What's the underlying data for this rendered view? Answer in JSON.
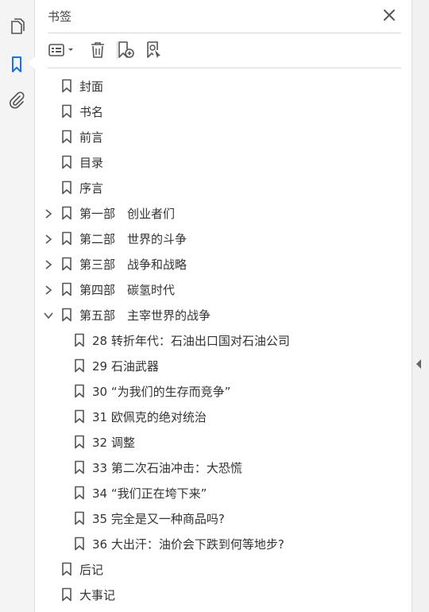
{
  "panel": {
    "title": "书签"
  },
  "bookmarks": [
    {
      "label": "封面",
      "level": 0,
      "expander": "none"
    },
    {
      "label": "书名",
      "level": 0,
      "expander": "none"
    },
    {
      "label": "前言",
      "level": 0,
      "expander": "none"
    },
    {
      "label": "目录",
      "level": 0,
      "expander": "none"
    },
    {
      "label": "序言",
      "level": 0,
      "expander": "none"
    },
    {
      "label": "第一部　创业者们",
      "level": 0,
      "expander": "collapsed"
    },
    {
      "label": "第二部　世界的斗争",
      "level": 0,
      "expander": "collapsed"
    },
    {
      "label": "第三部　战争和战略",
      "level": 0,
      "expander": "collapsed"
    },
    {
      "label": "第四部　碳氢时代",
      "level": 0,
      "expander": "collapsed"
    },
    {
      "label": "第五部　主宰世界的战争",
      "level": 0,
      "expander": "expanded"
    },
    {
      "label": "28 转折年代：石油出口国对石油公司",
      "level": 1,
      "expander": "none"
    },
    {
      "label": "29 石油武器",
      "level": 1,
      "expander": "none"
    },
    {
      "label": "30 “为我们的生存而竞争”",
      "level": 1,
      "expander": "none"
    },
    {
      "label": "31 欧佩克的绝对统治",
      "level": 1,
      "expander": "none"
    },
    {
      "label": "32 调整",
      "level": 1,
      "expander": "none"
    },
    {
      "label": "33 第二次石油冲击：大恐慌",
      "level": 1,
      "expander": "none"
    },
    {
      "label": "34 “我们正在垮下来”",
      "level": 1,
      "expander": "none"
    },
    {
      "label": "35 完全是又一种商品吗?",
      "level": 1,
      "expander": "none"
    },
    {
      "label": "36 大出汗：油价会下跌到何等地步?",
      "level": 1,
      "expander": "none"
    },
    {
      "label": "后记",
      "level": 0,
      "expander": "none"
    },
    {
      "label": "大事记",
      "level": 0,
      "expander": "none"
    }
  ],
  "colors": {
    "accent": "#1473e6",
    "icon": "#555555",
    "text": "#333333"
  }
}
